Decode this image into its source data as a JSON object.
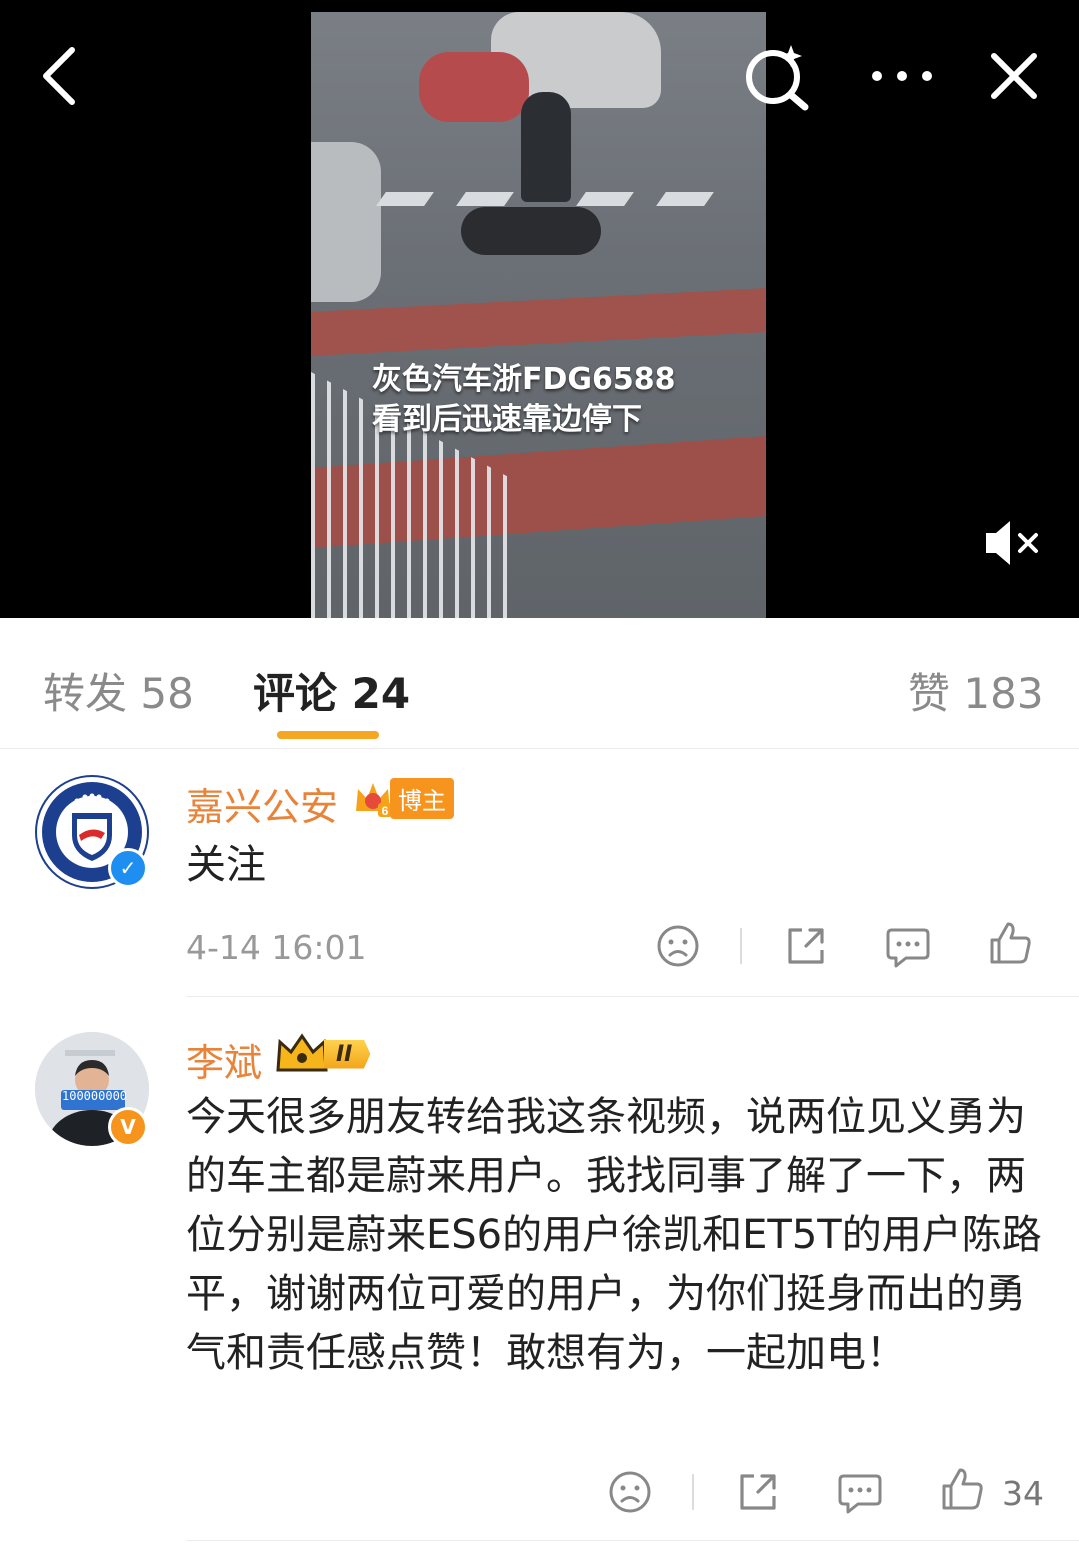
{
  "video": {
    "caption_line1": "灰色汽车浙FDG6588",
    "caption_line2": "看到后迅速靠边停下"
  },
  "tabs": [
    {
      "label": "转发",
      "count": "58"
    },
    {
      "label": "评论",
      "count": "24"
    },
    {
      "label": "赞",
      "count": "183"
    }
  ],
  "comments": [
    {
      "username": "嘉兴公安",
      "badge": "博主",
      "badge_level": "6",
      "avatar_text_top": "嘉兴公安",
      "avatar_text_bottom": "JIAXING POL",
      "text": "关注",
      "time": "4-14 16:01",
      "likes": ""
    },
    {
      "username": "李斌",
      "badge": "II",
      "avatar_sign": "100000000",
      "text": "今天很多朋友转给我这条视频，说两位见义勇为的车主都是蔚来用户。我找同事了解了一下，两位分别是蔚来ES6的用户徐凯和ET5T的用户陈路平，谢谢两位可爱的用户，为你们挺身而出的勇气和责任感点赞！敢想有为，一起加电！",
      "likes": "34"
    }
  ],
  "colors": {
    "accent": "#f5a623",
    "username": "#e8833a",
    "verified_blue": "#1f8ef1",
    "verified_orange": "#f7941d"
  },
  "icons": [
    "back-icon",
    "search-ai-icon",
    "more-icon",
    "close-icon",
    "mute-icon",
    "dislike-icon",
    "share-icon",
    "comment-icon",
    "like-icon"
  ]
}
